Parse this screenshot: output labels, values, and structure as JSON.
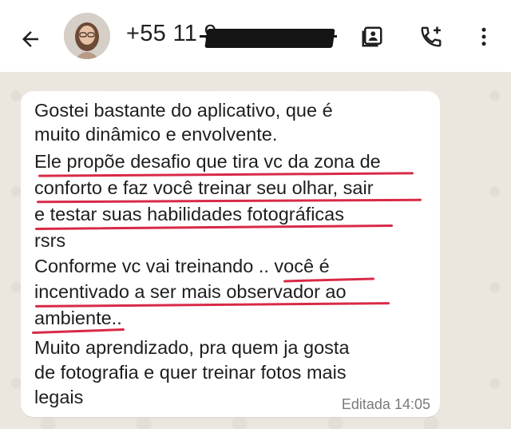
{
  "header": {
    "back_icon": "arrow-left-icon",
    "contact_number": "+55 11 9",
    "contact_number_redacted": true,
    "actions": [
      "contact-card-icon",
      "add-call-icon",
      "more-vert-icon"
    ]
  },
  "message": {
    "lines": [
      "Gostei bastante do aplicativo, que é",
      "muito dinâmico e envolvente.",
      "Ele propõe desafio que tira vc da zona de",
      "conforto e faz você treinar seu olhar, sair",
      "e testar suas habilidades fotográficas",
      "rsrs",
      "Conforme vc vai treinando .. você é",
      "incentivado a ser mais observador ao",
      "ambiente..",
      "Muito aprendizado, pra quem ja gosta",
      "de fotografia e quer treinar fotos mais",
      "legais"
    ],
    "edited_label": "Editada",
    "time": "14:05"
  },
  "colors": {
    "underline": "#d82a47",
    "bubble": "#ffffff",
    "chat_background": "#ebe6de"
  }
}
